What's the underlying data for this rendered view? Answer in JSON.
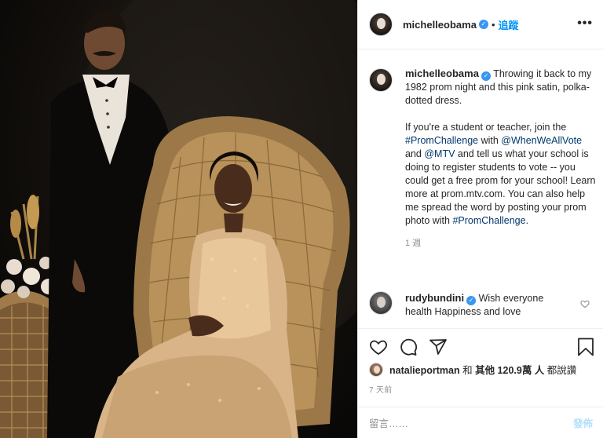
{
  "post": {
    "author": "michelleobama",
    "follow_label": "追蹤",
    "separator": "•",
    "more_label": "•••"
  },
  "caption": {
    "author": "michelleobama",
    "line1_text": "Throwing it back to my 1982 prom night and this pink satin, polka-dotted dress.",
    "p2_a": "If you're a student or teacher, join the ",
    "p2_tag1": "#PromChallenge",
    "p2_b": " with ",
    "p2_tag2": "@WhenWeAllVote",
    "p2_c": " and ",
    "p2_tag3": "@MTV",
    "p2_d": " and tell us what your school is doing to register students to vote -- you could get a free prom for your school! Learn more at prom.mtv.com. You can also help me spread the word by posting your prom photo with ",
    "p2_tag4": "#PromChallenge",
    "p2_e": ".",
    "age": "1 週"
  },
  "comment": {
    "author": "rudybundini",
    "text": "Wish everyone health Happiness and love"
  },
  "likes": {
    "user": "natalieportman",
    "mid": " 和 ",
    "others": "其他 120.9萬 人",
    "end": " 都說讚"
  },
  "date": "7 天前",
  "add_comment": {
    "placeholder": "留言……",
    "post_label": "發佈"
  },
  "icons": {
    "verified": "verified-badge-icon",
    "heart": "heart-icon",
    "comment": "comment-icon",
    "share": "share-icon",
    "save": "bookmark-icon",
    "more": "more-options-icon"
  },
  "colors": {
    "link": "#0095f6",
    "hashtag": "#00376b",
    "muted": "#8e8e8e",
    "post_disabled": "#b2dffc",
    "verified": "#3897f0"
  }
}
